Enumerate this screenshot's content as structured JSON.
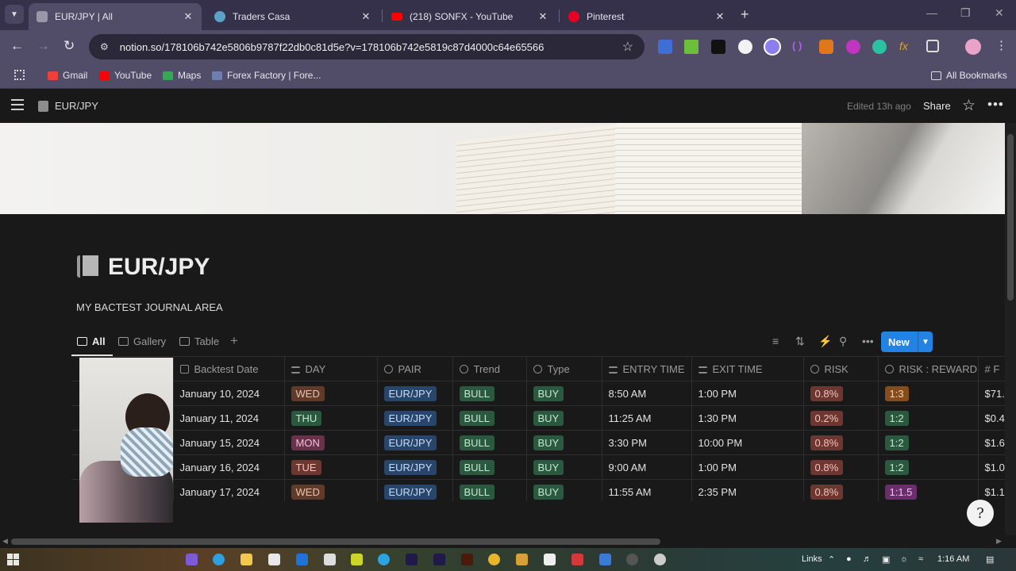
{
  "browser": {
    "tabs": [
      {
        "title": "EUR/JPY | All",
        "active": true,
        "favicon_color": "#9a97a8"
      },
      {
        "title": "Traders Casa",
        "active": false,
        "favicon_color": "#5aa3c6"
      },
      {
        "title": "(218) SONFX - YouTube",
        "active": false,
        "favicon_color": "#ff0000"
      },
      {
        "title": "Pinterest",
        "active": false,
        "favicon_color": "#e60023"
      }
    ],
    "url": "notion.so/178106b742e5806b9787f22db0c81d5e?v=178106b742e5819c87d4000c64e65566",
    "bookmarks": [
      {
        "label": "Gmail",
        "color": "#ea4335"
      },
      {
        "label": "YouTube",
        "color": "#ff0000"
      },
      {
        "label": "Maps",
        "color": "#34a853"
      },
      {
        "label": "Forex Factory | Fore...",
        "color": "#6d7fb0"
      }
    ],
    "all_bookmarks": "All Bookmarks"
  },
  "notion": {
    "breadcrumb": "EUR/JPY",
    "edited": "Edited 13h ago",
    "share": "Share",
    "page_title": "EUR/JPY",
    "description": "MY BACTEST JOURNAL AREA",
    "views": [
      "All",
      "Gallery",
      "Table"
    ],
    "new_button": "New",
    "columns": [
      "Backtest Date",
      "DAY",
      "PAIR",
      "Trend",
      "Type",
      "ENTRY TIME",
      "EXIT TIME",
      "RISK",
      "RISK : REWARD",
      "#"
    ],
    "rows": [
      {
        "date": "January 10, 2024",
        "day": "WED",
        "pair": "EUR/JPY",
        "trend": "BULL",
        "type": "BUY",
        "entry": "8:50 AM",
        "exit": "1:00 PM",
        "risk": "0.8%",
        "rr": "1:3",
        "amount": "$71."
      },
      {
        "date": "January 11, 2024",
        "day": "THU",
        "pair": "EUR/JPY",
        "trend": "BULL",
        "type": "BUY",
        "entry": "11:25 AM",
        "exit": "1:30 PM",
        "risk": "0.2%",
        "rr": "1:2",
        "amount": "$0.4"
      },
      {
        "date": "January 15, 2024",
        "day": "MON",
        "pair": "EUR/JPY",
        "trend": "BULL",
        "type": "BUY",
        "entry": "3:30 PM",
        "exit": "10:00 PM",
        "risk": "0.8%",
        "rr": "1:2",
        "amount": "$1.6"
      },
      {
        "date": "January 16, 2024",
        "day": "TUE",
        "pair": "EUR/JPY",
        "trend": "BULL",
        "type": "BUY",
        "entry": "9:00 AM",
        "exit": "1:00 PM",
        "risk": "0.8%",
        "rr": "1:2",
        "amount": "$1.0"
      },
      {
        "date": "January 17, 2024",
        "day": "WED",
        "pair": "EUR/JPY",
        "trend": "BULL",
        "type": "BUY",
        "entry": "11:55 AM",
        "exit": "2:35 PM",
        "risk": "0.8%",
        "rr": "1:1.5",
        "amount": "$1.1"
      }
    ]
  },
  "taskbar": {
    "links": "Links",
    "time": "1:16 AM"
  },
  "colors": {
    "accent": "#2383e2",
    "chrome_frame": "#35314a",
    "chrome_toolbar": "#514c67",
    "page_bg": "#191919"
  }
}
